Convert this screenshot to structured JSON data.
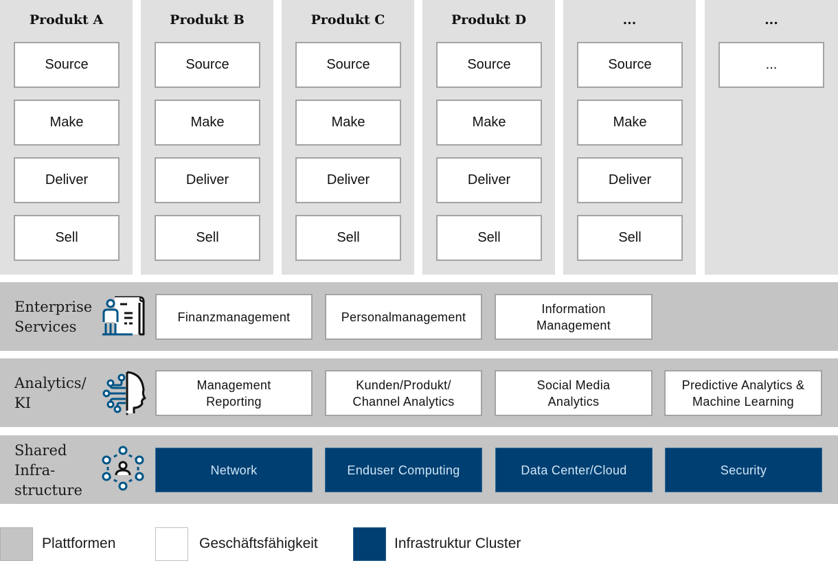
{
  "colors": {
    "platform_bg": "#e0e0e0",
    "band_bg": "#c4c4c4",
    "capability_bg": "#ffffff",
    "infra_bg": "#003f72",
    "infra_text": "#cfe6f5",
    "icon_accent": "#005587"
  },
  "products": [
    {
      "title": "Produkt A",
      "capabilities": [
        "Source",
        "Make",
        "Deliver",
        "Sell"
      ]
    },
    {
      "title": "Produkt B",
      "capabilities": [
        "Source",
        "Make",
        "Deliver",
        "Sell"
      ]
    },
    {
      "title": "Produkt C",
      "capabilities": [
        "Source",
        "Make",
        "Deliver",
        "Sell"
      ]
    },
    {
      "title": "Produkt D",
      "capabilities": [
        "Source",
        "Make",
        "Deliver",
        "Sell"
      ]
    },
    {
      "title": "...",
      "capabilities": [
        "Source",
        "Make",
        "Deliver",
        "Sell"
      ]
    },
    {
      "title": "...",
      "capabilities": [
        "..."
      ]
    }
  ],
  "bands": [
    {
      "label": "Enterprise\nServices",
      "icon": "person-document-icon",
      "items": [
        "Finanzmanagement",
        "Personalmanagement",
        "Information\nManagement"
      ]
    },
    {
      "label": "Analytics/\nKI",
      "icon": "ai-head-circuit-icon",
      "items": [
        "Management\nReporting",
        "Kunden/Produkt/\nChannel Analytics",
        "Social Media\nAnalytics",
        "Predictive Analytics &\nMachine Learning"
      ]
    },
    {
      "label": "Shared\nInfra-\nstructure",
      "icon": "network-user-icon",
      "items": [
        "Network",
        "Enduser Computing",
        "Data Center/Cloud",
        "Security"
      ]
    }
  ],
  "legend": [
    {
      "label": "Plattformen",
      "color": "#c4c4c4"
    },
    {
      "label": "Geschäftsfähigkeit",
      "color": "#ffffff"
    },
    {
      "label": "Infrastruktur Cluster",
      "color": "#003f72"
    }
  ]
}
